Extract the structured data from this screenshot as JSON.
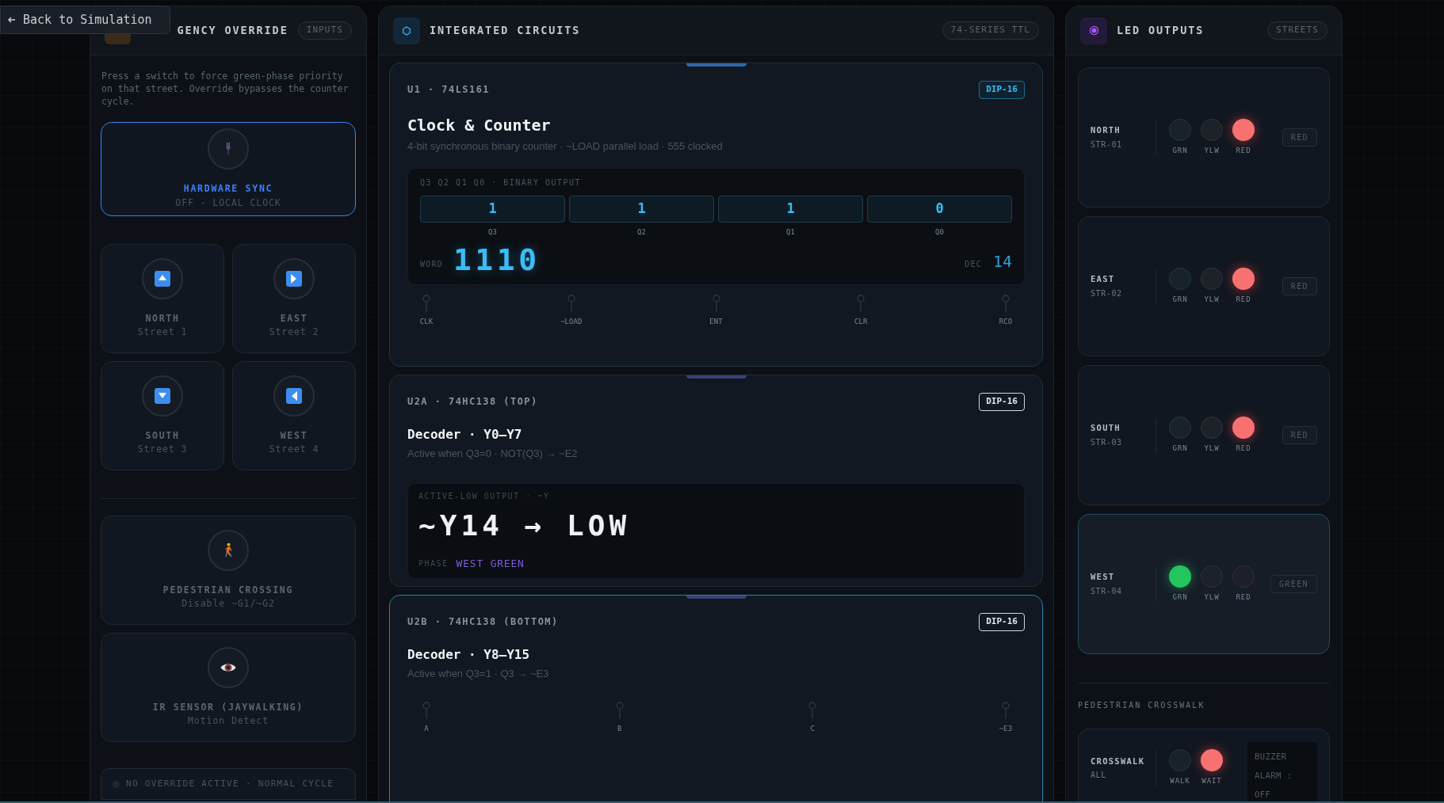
{
  "back_button": {
    "label": "Back to Simulation"
  },
  "inputs_panel": {
    "title": "GENCY OVERRIDE",
    "badge": "INPUTS",
    "description": "Press a switch to force green-phase priority on that street. Override bypasses the counter cycle.",
    "sync": {
      "title": "HARDWARE SYNC",
      "subtitle": "OFF - LOCAL CLOCK",
      "selected": true
    },
    "directions": [
      {
        "label": "NORTH",
        "sub": "Street 1",
        "kind": "up",
        "selected": false
      },
      {
        "label": "EAST",
        "sub": "Street 2",
        "kind": "right",
        "selected": false
      },
      {
        "label": "SOUTH",
        "sub": "Street 3",
        "kind": "down",
        "selected": false
      },
      {
        "label": "WEST",
        "sub": "Street 4",
        "kind": "left",
        "selected": false
      }
    ],
    "extras": [
      {
        "kind": "pedestrian",
        "label": "PEDESTRIAN CROSSING",
        "sub": "Disable ~G1/~G2",
        "selected": false
      },
      {
        "kind": "sensor",
        "label": "IR SENSOR (JAYWALKING)",
        "sub": "Motion Detect",
        "selected": false
      }
    ],
    "status": {
      "text": "NO OVERRIDE ACTIVE · NORMAL CYCLE",
      "active": false
    }
  },
  "ic_panel": {
    "title": "INTEGRATED CIRCUITS",
    "badge": "74-SERIES TTL",
    "chips": [
      {
        "kind": "counter",
        "id": "U1 · 74LS161",
        "package": "DIP-16",
        "title": "Clock & Counter",
        "subtitle": "4-bit synchronous binary counter · ~LOAD parallel load · 555 clocked",
        "selected": false,
        "output_label": "Q3 Q2 Q1 Q0 · BINARY OUTPUT",
        "bits": [
          {
            "value": "1",
            "label": "Q3"
          },
          {
            "value": "1",
            "label": "Q2"
          },
          {
            "value": "1",
            "label": "Q1"
          },
          {
            "value": "0",
            "label": "Q0"
          }
        ],
        "word_label": "WORD",
        "word": "1110",
        "dec_label": "DEC",
        "dec": "14",
        "pins": [
          "CLK",
          "~LOAD",
          "ENT",
          "CLR",
          "RCO"
        ]
      },
      {
        "kind": "decoder",
        "id": "U2A · 74HC138 (TOP)",
        "package": "DIP-16",
        "title": "Decoder · Y0–Y7",
        "subtitle": "Active when Q3=0 · NOT(Q3) → ~E2",
        "selected": false,
        "output_label": "ACTIVE-LOW OUTPUT · ~Y",
        "output": "~Y14 → LOW",
        "phase_label": "PHASE",
        "phase": "WEST GREEN"
      },
      {
        "kind": "decoder",
        "id": "U2B · 74HC138 (BOTTOM)",
        "package": "DIP-16",
        "title": "Decoder · Y8–Y15",
        "subtitle": "Active when Q3=1 · Q3 → ~E3",
        "selected": true,
        "pins": [
          "A",
          "B",
          "C",
          "~E3"
        ]
      }
    ]
  },
  "led_panel": {
    "title": "LED OUTPUTS",
    "badge": "STREETS",
    "streets": [
      {
        "name": "NORTH",
        "code": "STR-01",
        "state": "RED",
        "selected": false,
        "lamps": [
          {
            "label": "GRN",
            "kind": "green",
            "on": false
          },
          {
            "label": "YLW",
            "kind": "yellow",
            "on": false
          },
          {
            "label": "RED",
            "kind": "red",
            "on": true
          }
        ]
      },
      {
        "name": "EAST",
        "code": "STR-02",
        "state": "RED",
        "selected": false,
        "lamps": [
          {
            "label": "GRN",
            "kind": "green",
            "on": false
          },
          {
            "label": "YLW",
            "kind": "yellow",
            "on": false
          },
          {
            "label": "RED",
            "kind": "red",
            "on": true
          }
        ]
      },
      {
        "name": "SOUTH",
        "code": "STR-03",
        "state": "RED",
        "selected": false,
        "lamps": [
          {
            "label": "GRN",
            "kind": "green",
            "on": false
          },
          {
            "label": "YLW",
            "kind": "yellow",
            "on": false
          },
          {
            "label": "RED",
            "kind": "red",
            "on": true
          }
        ]
      },
      {
        "name": "WEST",
        "code": "STR-04",
        "state": "GREEN",
        "selected": true,
        "lamps": [
          {
            "label": "GRN",
            "kind": "green",
            "on": true
          },
          {
            "label": "YLW",
            "kind": "yellow",
            "on": false
          },
          {
            "label": "RED",
            "kind": "red",
            "on": false
          }
        ]
      }
    ],
    "section_label": "PEDESTRIAN CROSSWALK",
    "crosswalk": {
      "name": "CROSSWALK",
      "code": "ALL",
      "lamps": [
        {
          "label": "WALK",
          "kind": "green",
          "on": false
        },
        {
          "label": "WAIT",
          "kind": "red",
          "on": true
        }
      ],
      "buzzer": "BUZZER ALARM : OFF"
    }
  }
}
